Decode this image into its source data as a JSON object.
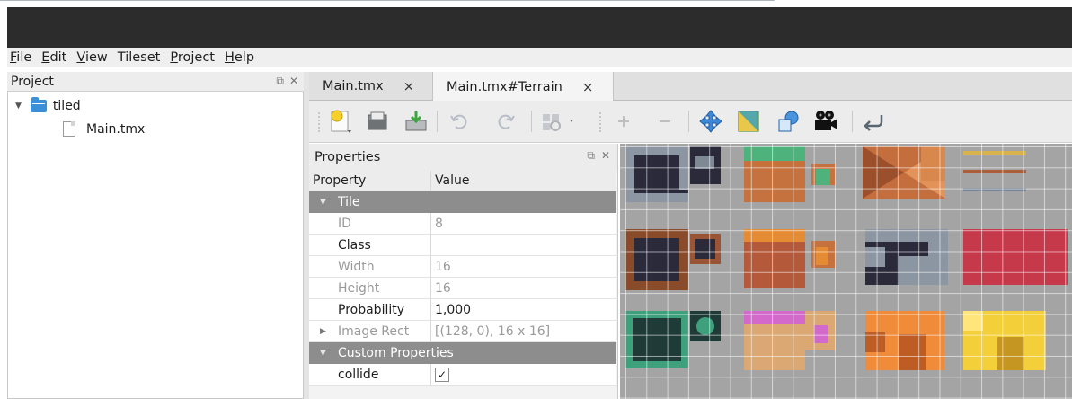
{
  "menu": [
    {
      "pre": "",
      "ul": "F",
      "post": "ile"
    },
    {
      "pre": "",
      "ul": "E",
      "post": "dit"
    },
    {
      "pre": "",
      "ul": "V",
      "post": "iew"
    },
    {
      "pre": "Tileset",
      "ul": "",
      "post": ""
    },
    {
      "pre": "",
      "ul": "P",
      "post": "roject"
    },
    {
      "pre": "",
      "ul": "H",
      "post": "elp"
    }
  ],
  "project_panel": {
    "title": "Project",
    "folder": "tiled",
    "file": "Main.tmx"
  },
  "tabs": [
    {
      "label": "Main.tmx",
      "close": "×"
    },
    {
      "label": "Main.tmx#Terrain",
      "close": "×"
    }
  ],
  "toolbar_icons": [
    "new-tileset-icon",
    "open-icon",
    "export-icon",
    "undo-icon",
    "redo-icon",
    "tileset-properties-icon",
    "add-tiles-icon",
    "remove-tiles-icon",
    "move-icon",
    "terrain-icon",
    "shapes-icon",
    "animation-icon",
    "back-icon"
  ],
  "properties": {
    "title": "Properties",
    "col_property": "Property",
    "col_value": "Value",
    "group_tile": "Tile",
    "rows": [
      {
        "name": "ID",
        "value": "8"
      },
      {
        "name": "Class",
        "value": ""
      },
      {
        "name": "Width",
        "value": "16"
      },
      {
        "name": "Height",
        "value": "16"
      },
      {
        "name": "Probability",
        "value": "1,000"
      },
      {
        "name": "Image Rect",
        "value": "[(128, 0), 16 x 16]"
      }
    ],
    "group_custom": "Custom Properties",
    "custom": [
      {
        "name": "collide",
        "checked": "✓"
      }
    ]
  },
  "colors": {
    "titlebar": "#2c2c2c",
    "group_row": "#8d8d8d",
    "tileset_bg": "#a4a4a4",
    "accent_blue": "#3b8fd6"
  }
}
